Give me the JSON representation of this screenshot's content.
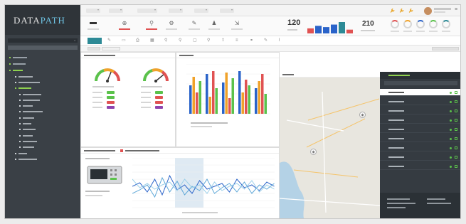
{
  "app": {
    "logo_part1": "DATA",
    "logo_part2": "PATH",
    "logo_wordmark_tm": "®"
  },
  "colors": {
    "accent": "#2d8a96",
    "sidebar": "#3a4046",
    "sidebar_dark": "#2f3439",
    "green": "#5bc24b",
    "orange": "#f0a22a",
    "red": "#e05252",
    "blue": "#2a63c9"
  },
  "status_strip": {
    "kpi_left_value": "120",
    "kpi_right_value": "210",
    "bar_values": [
      4,
      6,
      5,
      7,
      9,
      3
    ]
  },
  "gauges": [
    {
      "value": 0.62
    },
    {
      "value": 0.78
    }
  ],
  "asset_list": {
    "item_count": 9,
    "selected_index": 0
  },
  "chart_line": {
    "type": "line",
    "series_count": 3
  },
  "chart_bar": {
    "type": "bar",
    "series_count": 4
  }
}
